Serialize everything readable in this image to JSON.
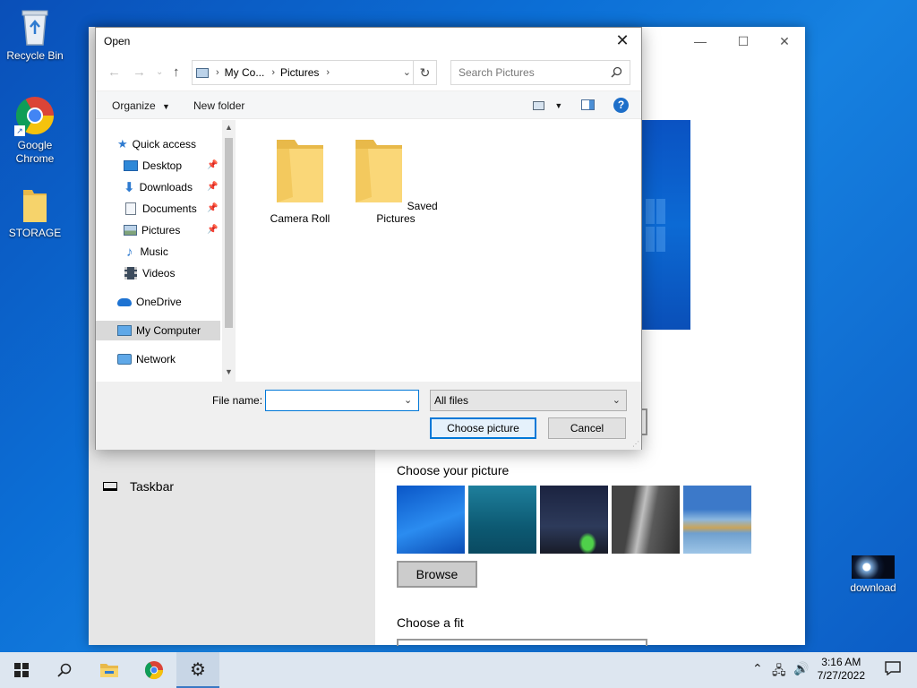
{
  "desktop": {
    "icons": [
      {
        "label": "Recycle Bin",
        "icon": "recycle-bin-icon"
      },
      {
        "label": "Google Chrome",
        "icon": "chrome-icon"
      },
      {
        "label": "STORAGE",
        "icon": "folder-icon"
      },
      {
        "label": "download",
        "icon": "image-file-icon"
      }
    ]
  },
  "settings": {
    "sidebar_item": "Taskbar",
    "choose_picture": "Choose your picture",
    "browse_label": "Browse",
    "choose_fit": "Choose a fit"
  },
  "dialog": {
    "title": "Open",
    "close_glyph": "✕",
    "address": {
      "crumbs": [
        "My Co...",
        "Pictures"
      ]
    },
    "search_placeholder": "Search Pictures",
    "commands": {
      "organize": "Organize",
      "new_folder": "New folder",
      "help": "?"
    },
    "nav": {
      "quick_access": "Quick access",
      "items": [
        {
          "label": "Desktop",
          "pinned": true
        },
        {
          "label": "Downloads",
          "pinned": true
        },
        {
          "label": "Documents",
          "pinned": true
        },
        {
          "label": "Pictures",
          "pinned": true
        },
        {
          "label": "Music",
          "pinned": false
        },
        {
          "label": "Videos",
          "pinned": false
        }
      ],
      "onedrive": "OneDrive",
      "my_computer": "My Computer",
      "network": "Network"
    },
    "files": [
      {
        "name": "Camera Roll"
      },
      {
        "name": "Saved Pictures"
      }
    ],
    "file_name_label": "File name:",
    "file_name_value": "",
    "filter_value": "All files",
    "choose_label": "Choose picture",
    "cancel_label": "Cancel"
  },
  "taskbar": {
    "time": "3:16 AM",
    "date": "7/27/2022",
    "accent": "#3a78c4"
  }
}
